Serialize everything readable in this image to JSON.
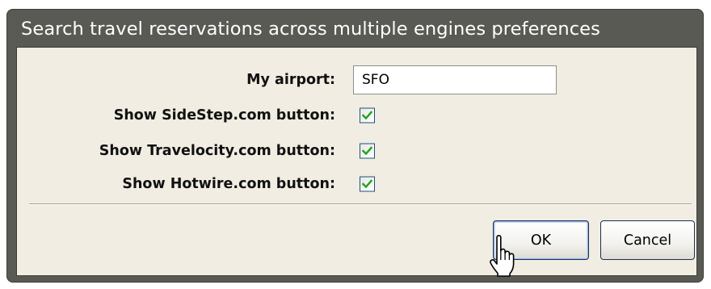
{
  "dialog": {
    "title": "Search travel reservations across multiple engines preferences"
  },
  "form": {
    "airport": {
      "label": "My airport:",
      "value": "SFO"
    },
    "checkboxes": [
      {
        "label": "Show SideStep.com button:",
        "checked": true
      },
      {
        "label": "Show Travelocity.com button:",
        "checked": true
      },
      {
        "label": "Show Hotwire.com button:",
        "checked": true
      }
    ]
  },
  "buttons": {
    "ok": "OK",
    "cancel": "Cancel"
  },
  "icons": {
    "checkmark": "checkmark-icon",
    "cursor": "hand-pointer-icon"
  },
  "colors": {
    "title_bar": "#5a5a55",
    "panel": "#f1ede2",
    "check": "#21a121"
  }
}
